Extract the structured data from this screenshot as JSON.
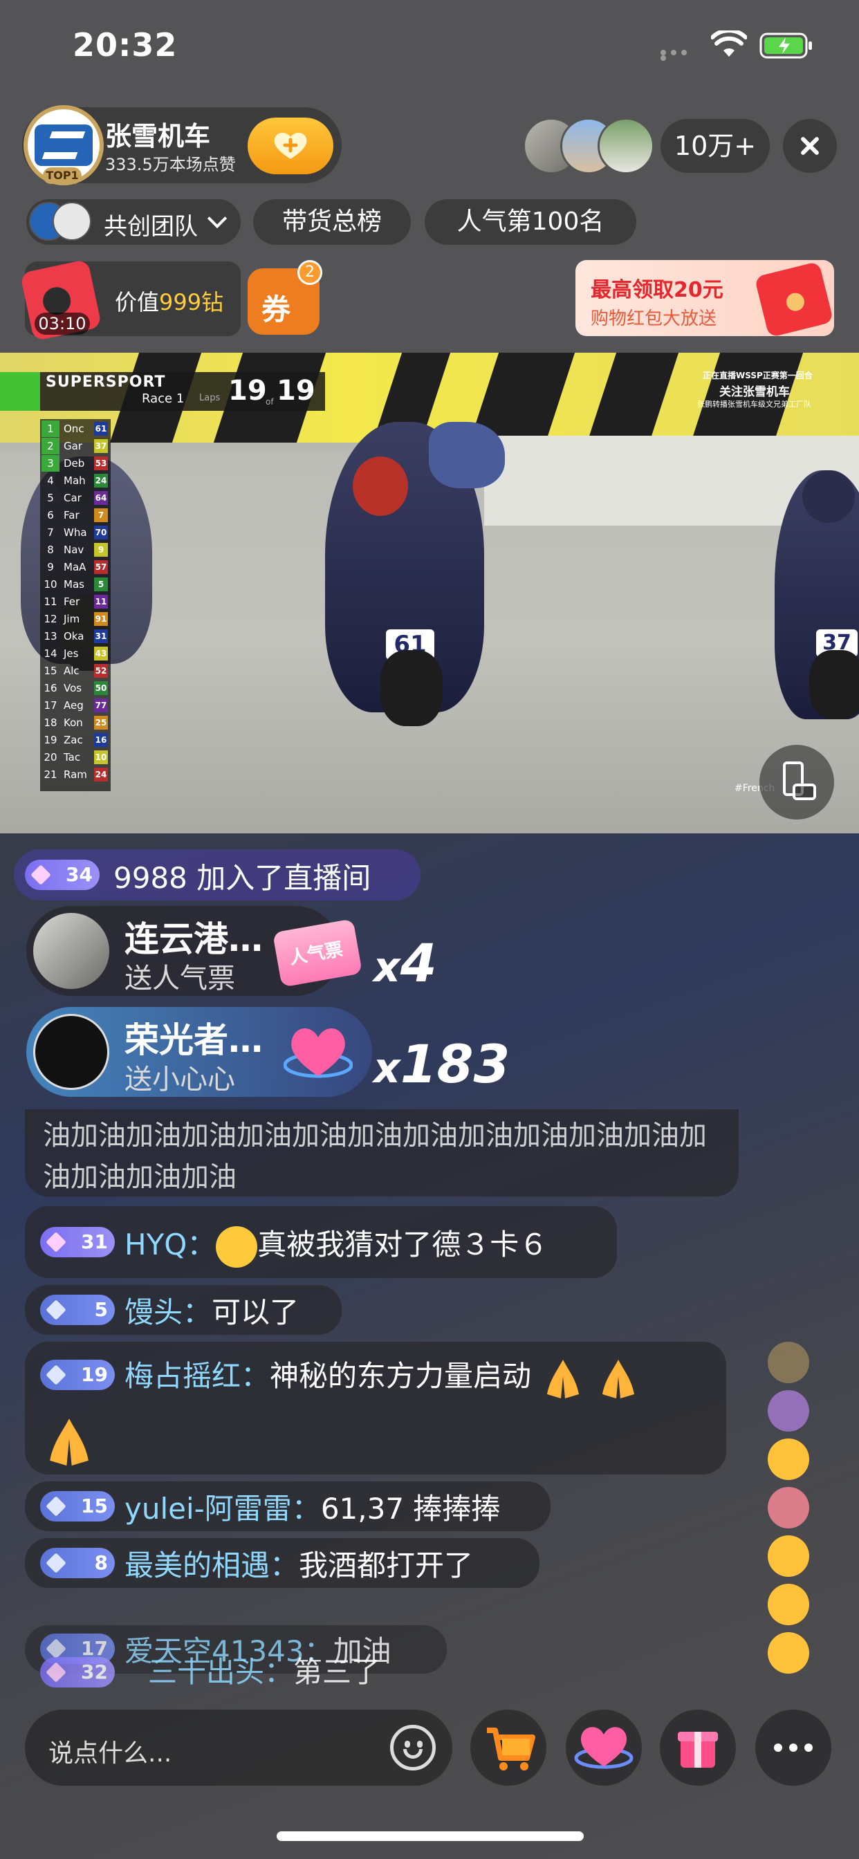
{
  "status_bar": {
    "time": "20:32"
  },
  "host": {
    "name": "张雪机车",
    "likes": "333.5万本场点赞",
    "badge": "TOP1"
  },
  "viewer_count": "10万+",
  "team": {
    "label": "共创团队"
  },
  "ranks": [
    "带货总榜",
    "人气第100名"
  ],
  "red_gift": {
    "timer": "03:10",
    "worth_prefix": "价值",
    "worth_value": "999钻"
  },
  "coupon": {
    "label": "券",
    "badge": "2"
  },
  "promo": {
    "title": "最高领取20元",
    "subtitle": "购物红包大放送"
  },
  "video": {
    "series": "SUPERSPORT",
    "race": "Race 1",
    "laps_label": "Laps",
    "lap_current": "19",
    "of_label": "of",
    "lap_total": "19",
    "standings": [
      {
        "pos": "1",
        "name": "Onc",
        "car": "61"
      },
      {
        "pos": "2",
        "name": "Gar",
        "car": "37"
      },
      {
        "pos": "3",
        "name": "Deb",
        "car": "53"
      },
      {
        "pos": "4",
        "name": "Mah",
        "car": "24"
      },
      {
        "pos": "5",
        "name": "Car",
        "car": "64"
      },
      {
        "pos": "6",
        "name": "Far",
        "car": "7"
      },
      {
        "pos": "7",
        "name": "Wha",
        "car": "70"
      },
      {
        "pos": "8",
        "name": "Nav",
        "car": "9"
      },
      {
        "pos": "9",
        "name": "MaA",
        "car": "57"
      },
      {
        "pos": "10",
        "name": "Mas",
        "car": "5"
      },
      {
        "pos": "11",
        "name": "Fer",
        "car": "11"
      },
      {
        "pos": "12",
        "name": "Jim",
        "car": "91"
      },
      {
        "pos": "13",
        "name": "Oka",
        "car": "31"
      },
      {
        "pos": "14",
        "name": "Jes",
        "car": "43"
      },
      {
        "pos": "15",
        "name": "Alc",
        "car": "52"
      },
      {
        "pos": "16",
        "name": "Vos",
        "car": "50"
      },
      {
        "pos": "17",
        "name": "Aeg",
        "car": "77"
      },
      {
        "pos": "18",
        "name": "Kon",
        "car": "25"
      },
      {
        "pos": "19",
        "name": "Zac",
        "car": "16"
      },
      {
        "pos": "20",
        "name": "Tac",
        "car": "10"
      },
      {
        "pos": "21",
        "name": "Ram",
        "car": "24"
      }
    ],
    "rider_numbers": [
      "61",
      "37"
    ],
    "watermark_line1": "正在直播WSSP正赛第一回合",
    "watermark_line2": "关注张雪机车",
    "watermark_line3": "张鹏转播张雪机车级文兄弟工厂队",
    "watermark_tag": "#French"
  },
  "chat": {
    "join": {
      "level": "34",
      "text": "9988 加入了直播间"
    },
    "gifts": [
      {
        "name": "连云港…",
        "sub": "送人气票",
        "gift_label": "人气票",
        "count": "4"
      },
      {
        "name": "荣光者…",
        "sub": "送小心心",
        "count": "183"
      }
    ],
    "count_prefix": "x",
    "plain_message": "油加油加油加油加油加油加油加油加油加油加油加油加油加油加油加油",
    "messages": [
      {
        "level": "31",
        "user": "HYQ：",
        "text": "真被我猜对了德３卡６"
      },
      {
        "level": "5",
        "user": "馒头：",
        "text": "可以了"
      },
      {
        "level": "19",
        "user": "梅占摇红：",
        "text": "神秘的东方力量启动"
      },
      {
        "level": "15",
        "user": "yulei-阿雷雷：",
        "text": "61,37 捧捧捧"
      },
      {
        "level": "8",
        "user": "最美的相遇：",
        "text": "我酒都打开了"
      },
      {
        "level": "17",
        "user": "爱天空41343：",
        "text": "加油"
      },
      {
        "level": "32",
        "user": "三十出头：",
        "text": "第三了"
      }
    ]
  },
  "bottom": {
    "input_placeholder": "说点什么..."
  },
  "colors": {
    "accent": "#ffc63a",
    "level_badge": "#8a7ff3",
    "username": "#8fd8ff",
    "promo_red": "#e5272d"
  }
}
